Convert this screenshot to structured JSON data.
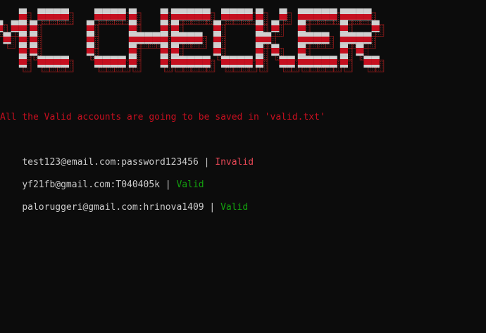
{
  "banner": {
    "text": "MC CHECKER",
    "colors": {
      "stripe_red": "#c50f1f",
      "stripe_white": "#d0d0d0",
      "shadow": "#8b1a1a",
      "background": "#0c0c0c"
    }
  },
  "notice": "All the Valid accounts are going to be saved in 'valid.txt'",
  "results": [
    {
      "account": "test123@email.com:password123456",
      "separator": " | ",
      "status": "Invalid",
      "status_color": "#e74856"
    },
    {
      "account": "yf21fb@gmail.com:T040405k",
      "separator": " | ",
      "status": "Valid",
      "status_color": "#13a10e"
    },
    {
      "account": "paloruggeri@gmail.com:hrinova1409",
      "separator": " | ",
      "status": "Valid",
      "status_color": "#13a10e"
    }
  ]
}
